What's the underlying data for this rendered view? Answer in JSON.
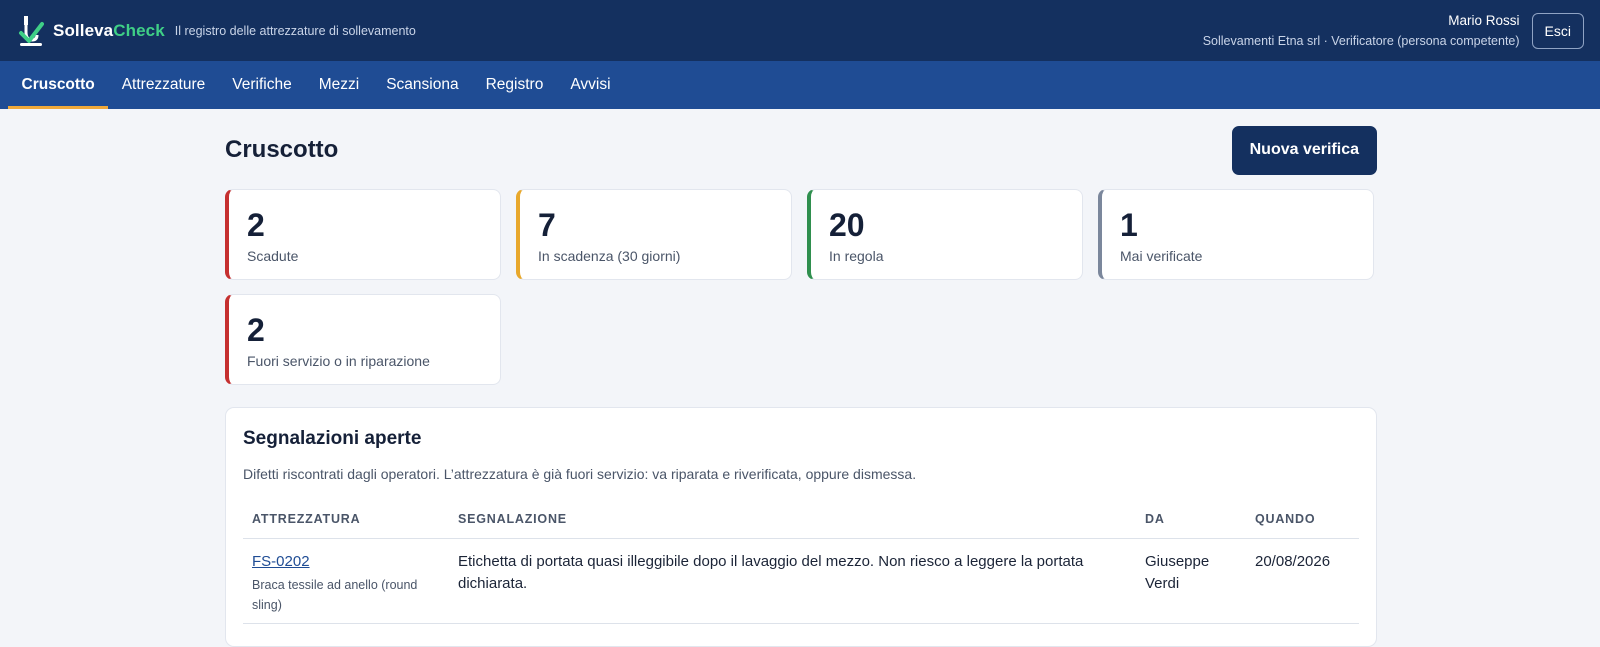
{
  "header": {
    "brand_part1": "Solleva",
    "brand_part2": "Check",
    "tagline": "Il registro delle attrezzature di sollevamento",
    "user_name": "Mario Rossi",
    "user_org": "Sollevamenti Etna srl · Verificatore (persona competente)",
    "logout_label": "Esci"
  },
  "nav": {
    "items": [
      {
        "label": "Cruscotto"
      },
      {
        "label": "Attrezzature"
      },
      {
        "label": "Verifiche"
      },
      {
        "label": "Mezzi"
      },
      {
        "label": "Scansiona"
      },
      {
        "label": "Registro"
      },
      {
        "label": "Avvisi"
      }
    ]
  },
  "page": {
    "title": "Cruscotto",
    "new_button": "Nuova verifica"
  },
  "stats": [
    {
      "value": "2",
      "label": "Scadute"
    },
    {
      "value": "7",
      "label": "In scadenza (30 giorni)"
    },
    {
      "value": "20",
      "label": "In regola"
    },
    {
      "value": "1",
      "label": "Mai verificate"
    },
    {
      "value": "2",
      "label": "Fuori servizio o in riparazione"
    }
  ],
  "reports": {
    "title": "Segnalazioni aperte",
    "description": "Difetti riscontrati dagli operatori. L’attrezzatura è già fuori servizio: va riparata e riverificata, oppure dismessa.",
    "columns": [
      "ATTREZZATURA",
      "SEGNALAZIONE",
      "DA",
      "QUANDO"
    ],
    "rows": [
      {
        "code": "FS-0202",
        "name": "Braca tessile ad anello (round sling)",
        "report": "Etichetta di portata quasi illeggibile dopo il lavaggio del mezzo. Non riesco a leggere la portata dichiarata.",
        "by": "Giuseppe Verdi",
        "when": "20/08/2026"
      }
    ]
  },
  "colors": {
    "topbar": "#14305f",
    "navbar": "#1f4c94",
    "active_underline": "#f0a93a",
    "brand_accent": "#3fcf86",
    "overdue": "#c53030",
    "expiring": "#e8a82c",
    "ok": "#2f8f4e",
    "never": "#7b879c"
  },
  "icons": {
    "logo": "lifting-hook-check-icon"
  }
}
